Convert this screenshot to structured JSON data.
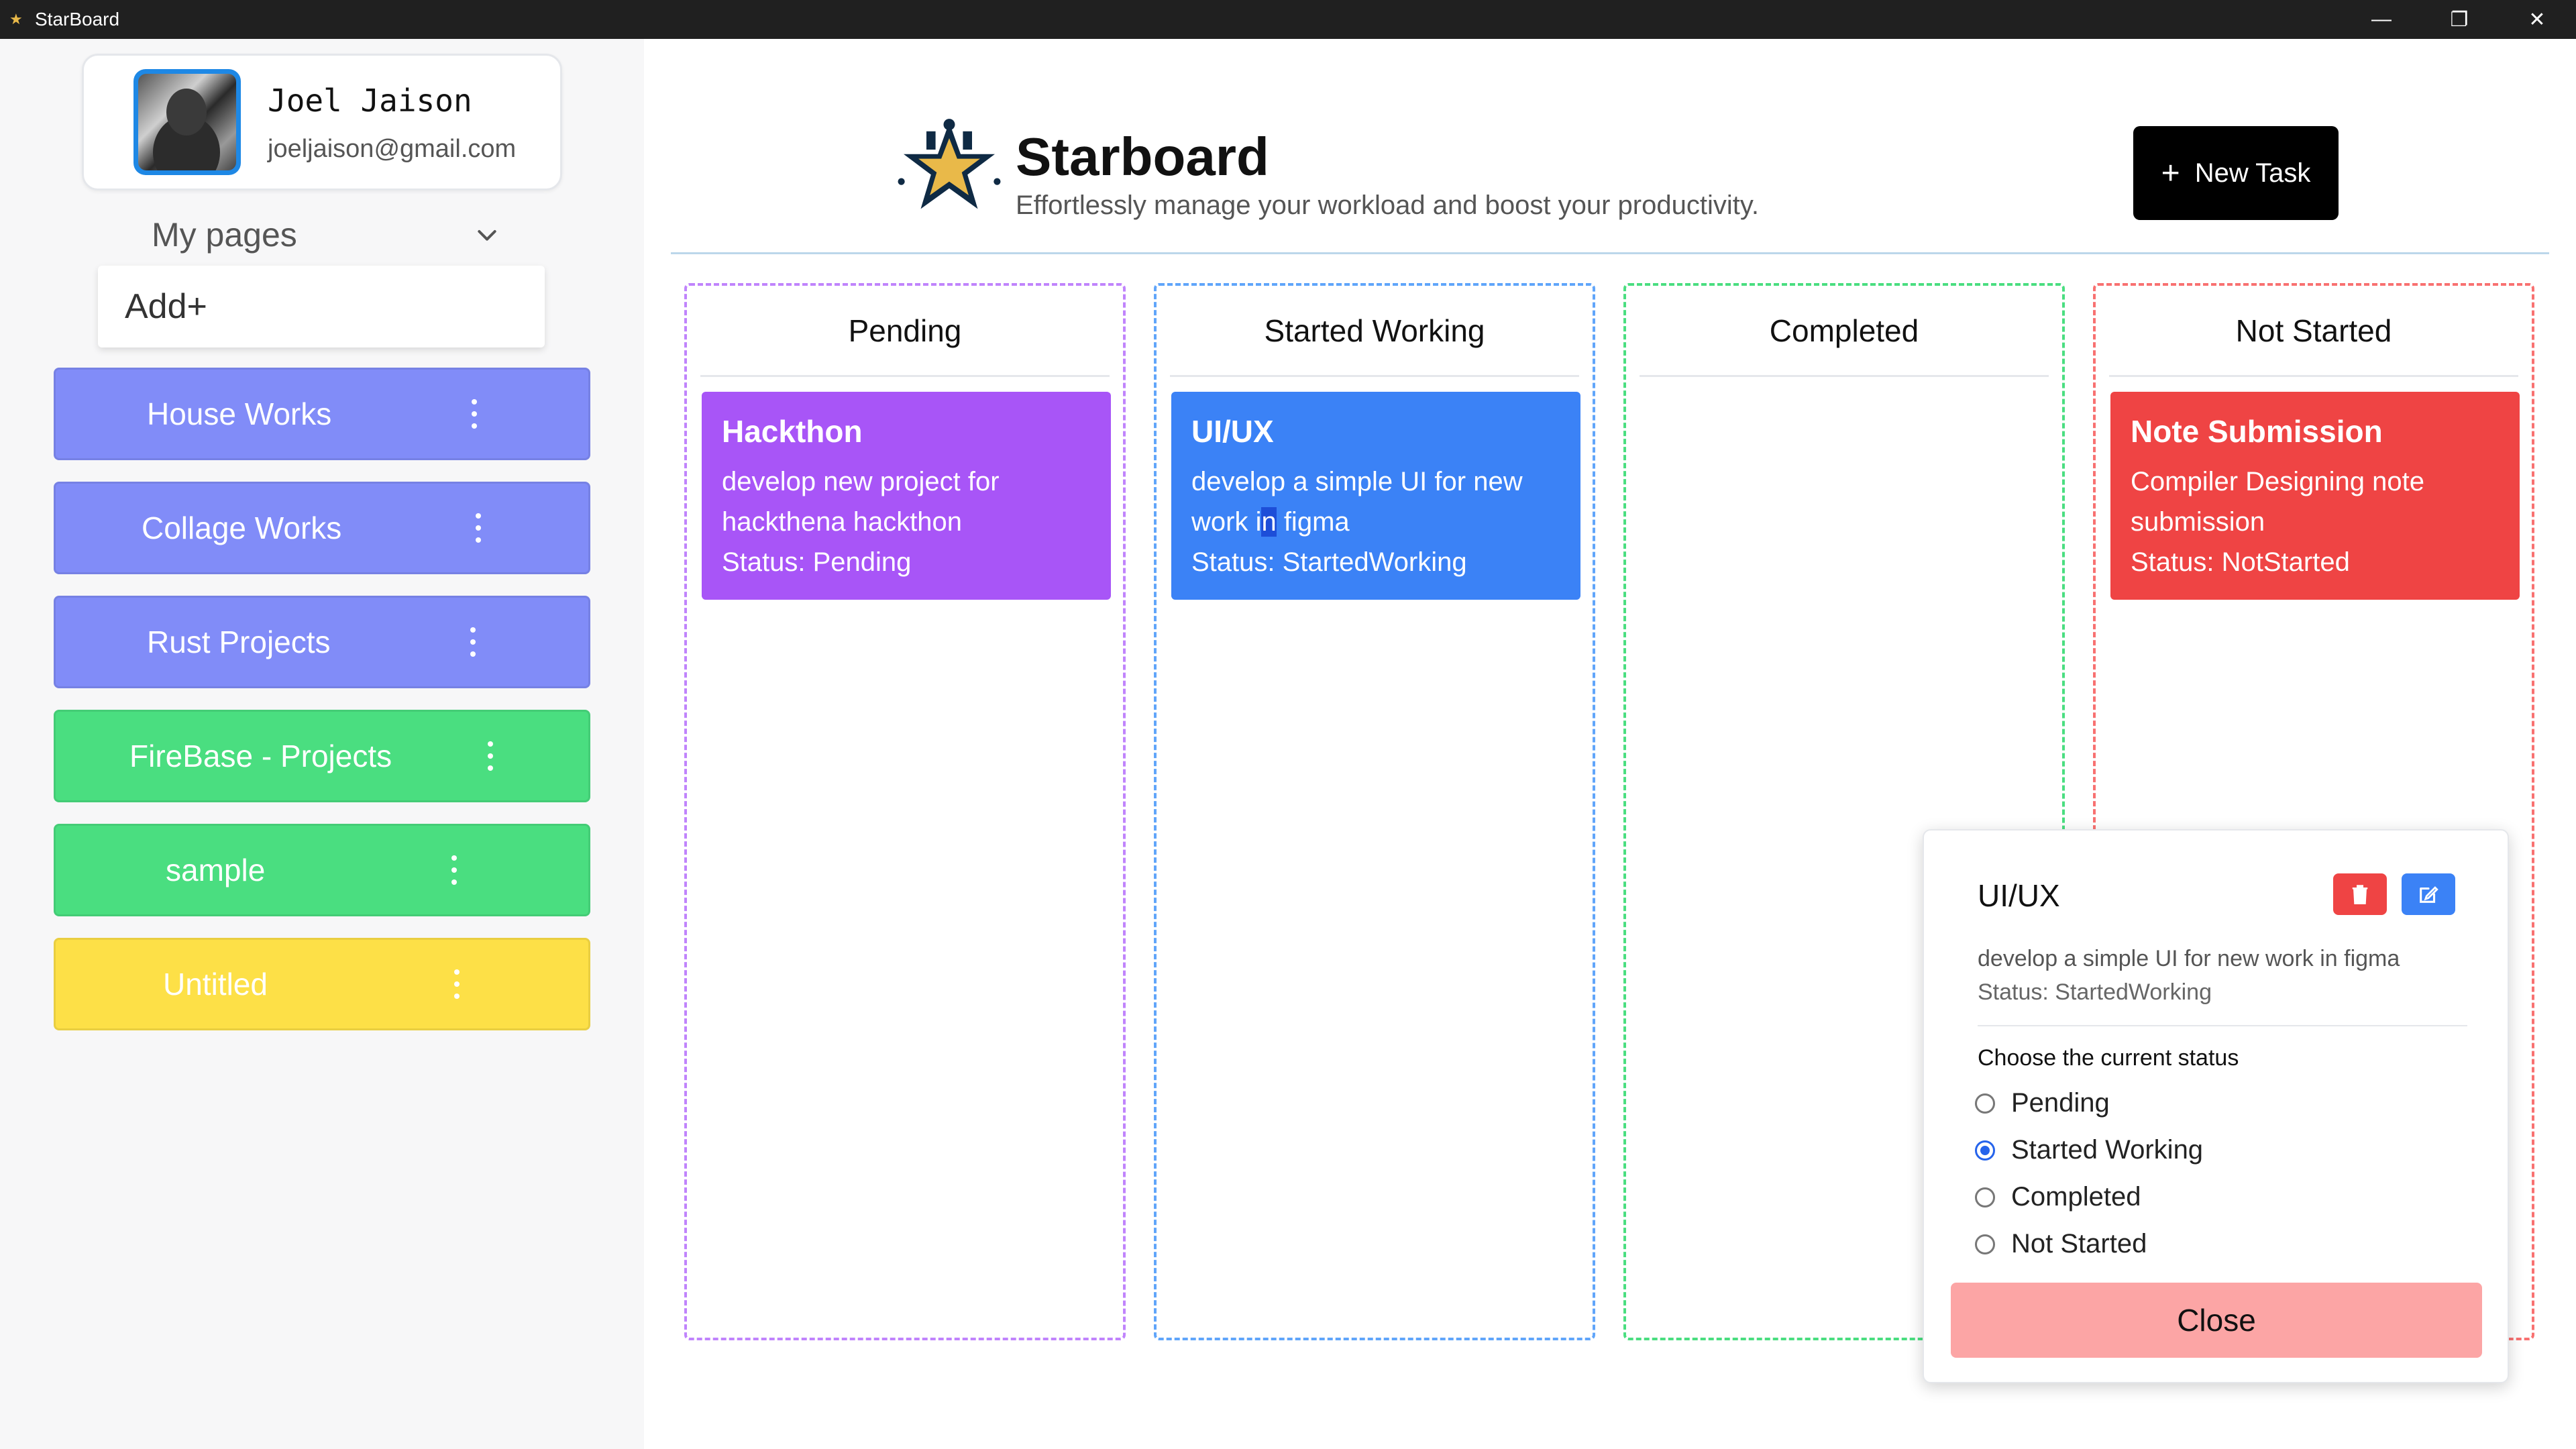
{
  "window": {
    "title": "StarBoard",
    "minimize": "—",
    "restore": "❐",
    "close": "✕"
  },
  "profile": {
    "name": "Joel Jaison",
    "email": "joeljaison@gmail.com"
  },
  "sidebar": {
    "my_pages_label": "My pages",
    "add_label": "Add+",
    "pages": [
      {
        "label": "House Works",
        "color": "#818cf8"
      },
      {
        "label": "Collage Works",
        "color": "#818cf8"
      },
      {
        "label": "Rust Projects",
        "color": "#818cf8"
      },
      {
        "label": "FireBase - Projects",
        "color": "#4ade80"
      },
      {
        "label": "sample",
        "color": "#4ade80"
      },
      {
        "label": "Untitled",
        "color": "#fde047"
      }
    ]
  },
  "header": {
    "app_name": "Starboard",
    "tagline": "Effortlessly manage your workload and boost your productivity.",
    "new_task_label": "New Task"
  },
  "columns": [
    {
      "title": "Pending",
      "border_color": "#c084fc"
    },
    {
      "title": "Started Working",
      "border_color": "#60a5fa"
    },
    {
      "title": "Completed",
      "border_color": "#4ade80"
    },
    {
      "title": "Not Started",
      "border_color": "#f87171"
    }
  ],
  "cards": {
    "pending": {
      "title": "Hackthon",
      "desc": "develop new project for hackthena hackthon",
      "status": "Status: Pending",
      "color": "#a855f7"
    },
    "started": {
      "title": "UI/UX",
      "desc_part1": "develop a simple UI for new work i",
      "desc_sel": "n",
      "desc_part2": " figma",
      "status": "Status: StartedWorking",
      "color": "#3b82f6"
    },
    "not_started": {
      "title": "Note Submission",
      "desc": "Compiler Designing note submission",
      "status": "Status: NotStarted",
      "color": "#ef4444"
    }
  },
  "modal": {
    "title": "UI/UX",
    "desc": "develop a simple UI for new work in figma",
    "status": "Status: StartedWorking",
    "choose_label": "Choose the current status",
    "options": [
      "Pending",
      "Started Working",
      "Completed",
      "Not Started"
    ],
    "selected": "Started Working",
    "close_label": "Close"
  }
}
